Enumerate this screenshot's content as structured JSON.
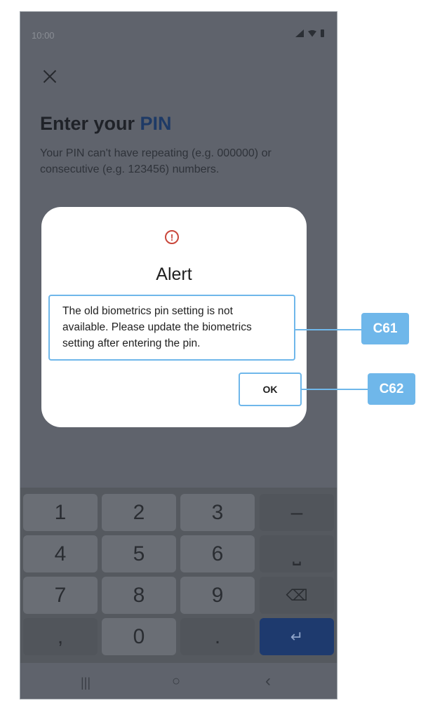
{
  "status": {
    "time": "10:00"
  },
  "screen": {
    "title_prefix": "Enter your",
    "title_highlight": "PIN",
    "description": "Your PIN can't have repeating (e.g. 000000) or consecutive (e.g. 123456) numbers."
  },
  "dialog": {
    "title": "Alert",
    "message": "The old biometrics pin setting is not available. Please update the biometrics setting after entering the pin.",
    "ok_label": "OK"
  },
  "keyboard": {
    "keys": [
      "1",
      "2",
      "3",
      "–",
      "4",
      "5",
      "6",
      "⎵",
      "7",
      "8",
      "9",
      "⌫",
      ",",
      "0",
      ".",
      "↵"
    ]
  },
  "navbar": {
    "recent": "|||",
    "home": "○",
    "back": "‹"
  },
  "callouts": {
    "c61": "C61",
    "c62": "C62"
  },
  "colors": {
    "accent": "#6fb7ea",
    "alert": "#c9473b",
    "pin_highlight": "#1e3a66"
  }
}
